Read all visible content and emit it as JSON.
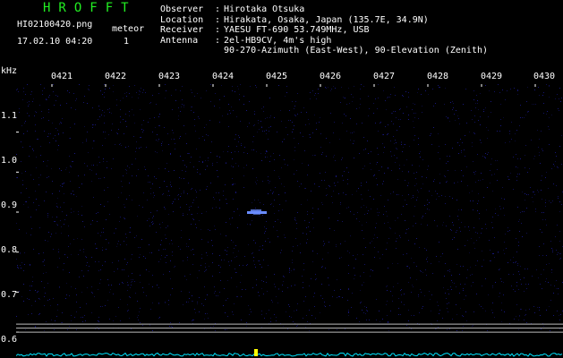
{
  "header": {
    "app_title": "HROFFT",
    "file_name": "HI02100420.png",
    "date_time": "17.02.10 04:20",
    "meteor_label": "meteor",
    "meteor_count": "1"
  },
  "info": {
    "observer": {
      "key": "Observer",
      "sep": ":",
      "value": "Hirotaka Otsuka"
    },
    "location": {
      "key": "Location",
      "sep": ":",
      "value": "Hirakata, Osaka, Japan (135.7E, 34.9N)"
    },
    "receiver": {
      "key": "Receiver",
      "sep": ":",
      "value": "YAESU FT-690 53.749MHz, USB"
    },
    "antenna": {
      "key": "Antenna",
      "sep": ":",
      "value": "2el-HB9CV, 4m's high"
    },
    "antenna_line2": "90-270-Azimuth (East-West), 90-Elevation (Zenith)"
  },
  "axes": {
    "unit": "kHz",
    "time_labels": [
      "0421",
      "0422",
      "0423",
      "0424",
      "0425",
      "0426",
      "0427",
      "0428",
      "0429",
      "0430"
    ],
    "freq_labels": [
      "1.1",
      "1.0",
      "0.9",
      "0.8",
      "0.7",
      "0.6"
    ]
  },
  "colors": {
    "background": "#000000",
    "title": "#22ee22",
    "text": "#ffffff",
    "noise": "#1a1a8a",
    "trace": "#00e5ff",
    "echo": "#6a8cff",
    "peak": "#ffff00",
    "ref_line": "#bbbbbb"
  },
  "plot": {
    "freq_min": 0.58,
    "freq_max": 1.22,
    "minutes": 10,
    "reference_freqs": [
      0.62,
      0.61,
      0.6
    ],
    "meteor_echo": {
      "minute": 4.8,
      "freq": 0.9
    },
    "power_peak_minute": 4.8
  }
}
